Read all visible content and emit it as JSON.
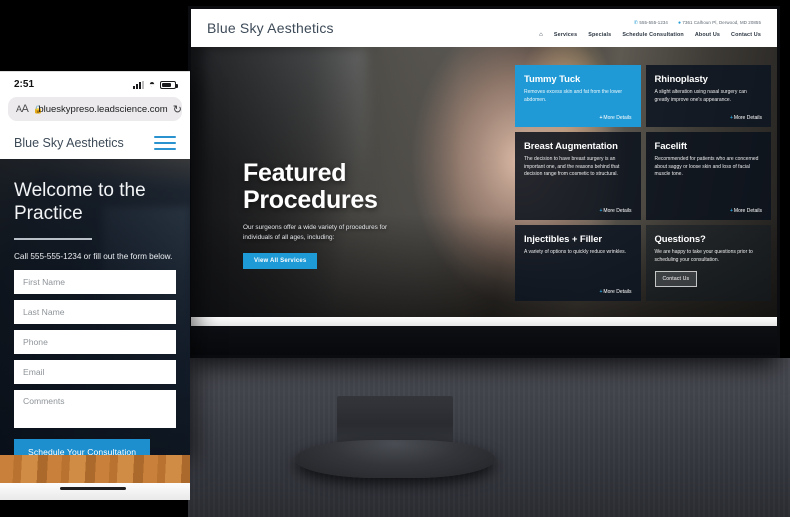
{
  "desktop": {
    "brand": "Blue Sky Aesthetics",
    "contact": {
      "phone": "555-555-1234",
      "address": "7361 Calhoun Pl, Derwood, MD 20855",
      "phone_icon": "phone-icon",
      "pin_icon": "map-pin-icon"
    },
    "nav": {
      "home_icon": "home-icon",
      "items": [
        "Services",
        "Specials",
        "Schedule Consultation",
        "About Us",
        "Contact Us"
      ]
    },
    "hero": {
      "title_line1": "Featured",
      "title_line2": "Procedures",
      "subtitle": "Our surgeons offer a wide variety of procedures for individuals of all ages, including:",
      "cta": "View All Services"
    },
    "cards": [
      {
        "title": "Tummy Tuck",
        "body": "Removes excess skin and fat from the lower abdomen.",
        "link": "More Details"
      },
      {
        "title": "Rhinoplasty",
        "body": "A slight alteration using nasal surgery can greatly improve one's appearance.",
        "link": "More Details"
      },
      {
        "title": "Breast Augmentation",
        "body": "The decision to have breast surgery is an important one, and the reasons behind that decision range from cosmetic to structural.",
        "link": "More Details"
      },
      {
        "title": "Facelift",
        "body": "Recommended for patients who are concerned about saggy or loose skin and loss of facial muscle tone.",
        "link": "More Details"
      },
      {
        "title": "Injectibles + Filler",
        "body": "A variety of options to quickly reduce wrinkles.",
        "link": "More Details"
      },
      {
        "title": "Questions?",
        "body": "We are happy to take your questions prior to scheduling your consultation.",
        "cta": "Contact Us"
      }
    ]
  },
  "phone": {
    "status": {
      "time": "2:51",
      "signal_icon": "cellular-signal-icon",
      "wifi_icon": "wifi-icon",
      "battery_icon": "battery-icon"
    },
    "browser": {
      "text_size_label": "AA",
      "lock_icon": "lock-icon",
      "url": "blueskypreso.leadscience.com",
      "reload_icon": "reload-icon"
    },
    "site": {
      "brand": "Blue Sky Aesthetics",
      "menu_icon": "hamburger-menu-icon"
    },
    "hero": {
      "title": "Welcome to the Practice",
      "call_text": "Call 555-555-1234 or fill out the form below."
    },
    "form": {
      "fields": [
        {
          "placeholder": "First Name",
          "name": "first-name-field"
        },
        {
          "placeholder": "Last Name",
          "name": "last-name-field"
        },
        {
          "placeholder": "Phone",
          "name": "phone-field"
        },
        {
          "placeholder": "Email",
          "name": "email-field"
        }
      ],
      "comments_placeholder": "Comments",
      "submit": "Schedule Your Consultation"
    }
  },
  "colors": {
    "accent": "#1e9ad6",
    "dark_card": "#0e1621",
    "brand_text": "#3d4a57"
  }
}
